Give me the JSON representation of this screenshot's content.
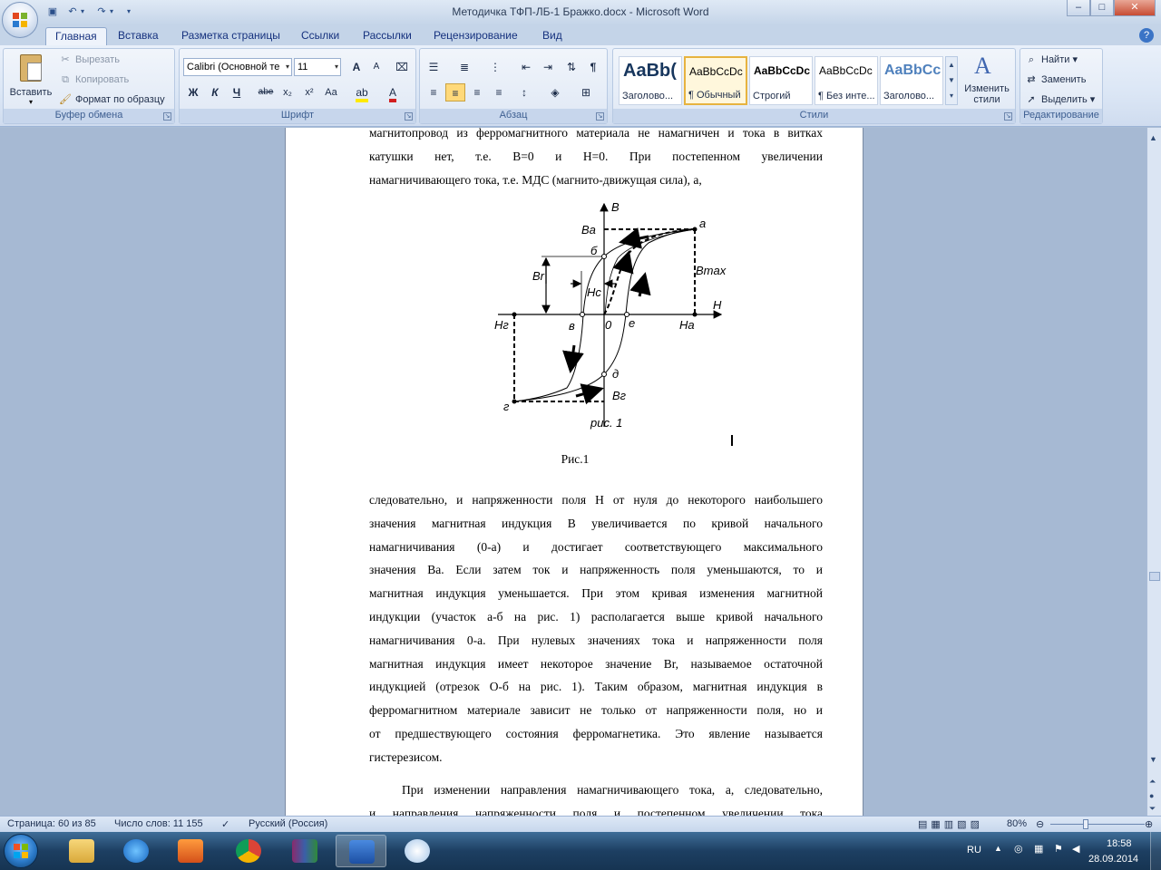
{
  "window": {
    "title": "Методичка ТФП-ЛБ-1 Бражко.docx - Microsoft Word",
    "minimize": "–",
    "maximize": "□",
    "close": "✕"
  },
  "qat": {
    "save_icon": "save-icon",
    "undo_icon": "undo-icon",
    "redo_icon": "redo-icon"
  },
  "tabs": [
    "Главная",
    "Вставка",
    "Разметка страницы",
    "Ссылки",
    "Рассылки",
    "Рецензирование",
    "Вид"
  ],
  "ribbon": {
    "clipboard": {
      "label": "Буфер обмена",
      "paste": "Вставить",
      "cut": "Вырезать",
      "copy": "Копировать",
      "format_painter": "Формат по образцу"
    },
    "font": {
      "label": "Шрифт",
      "font_name": "Calibri (Основной те",
      "font_size": "11",
      "bold": "Ж",
      "italic": "К",
      "underline": "Ч",
      "strike": "abe",
      "subscript": "x₂",
      "superscript": "x²",
      "change_case": "Aa",
      "grow": "A",
      "shrink": "A"
    },
    "paragraph": {
      "label": "Абзац"
    },
    "styles": {
      "label": "Стили",
      "items": [
        {
          "sample": "AaBb(",
          "name": "Заголово..."
        },
        {
          "sample": "AaBbCcDc",
          "name": "¶ Обычный"
        },
        {
          "sample": "AaBbCcDc",
          "name": "Строгий"
        },
        {
          "sample": "AaBbCcDc",
          "name": "¶ Без инте..."
        },
        {
          "sample": "AaBbCc",
          "name": "Заголово..."
        }
      ],
      "change_styles": "Изменить стили"
    },
    "editing": {
      "label": "Редактирование",
      "find": "Найти",
      "replace": "Заменить",
      "select": "Выделить"
    }
  },
  "document": {
    "para1": [
      "магнитопровод из ферромагнитного материала не намагничен и тока в витках",
      "катушки   нет,   т.е.   B=0   и   H=0.   При   постепенном   увеличении",
      "намагничивающего тока, т.е. МДС (магнито-движущая сила), а,"
    ],
    "figure": {
      "axis_B": "B",
      "axis_H": "H",
      "Ba": "Bа",
      "a": "а",
      "b": "б",
      "Br": "Br",
      "Bmax": "Bmax",
      "Hc": "Hc",
      "Hg": "Hг",
      "v": "в",
      "zero": "0",
      "e": "е",
      "Ha": "Hа",
      "d": "д",
      "Bg": "Bг",
      "g": "г",
      "fig_label": "рис. 1"
    },
    "caption": "Рис.1",
    "para2": [
      "следовательно, и напряженности поля H от нуля до некоторого наибольшего",
      "значения  магнитная индукция B увеличивается по кривой начального",
      "намагничивания (0-а) и достигает соответствующего максимального",
      "значения Ba. Если затем ток и напряженность поля уменьшаются, то и",
      "магнитная индукция уменьшается. При этом кривая изменения магнитной",
      "индукции (участок а-б на рис. 1) располагается выше кривой начального",
      "намагничивания 0-а. При нулевых значениях тока и напряженности поля",
      "магнитная индукция имеет некоторое значение Br, называемое остаточной",
      "индукцией (отрезок О-б на рис. 1). Таким образом, магнитная индукция в",
      "ферромагнитном материале зависит не только от напряженности поля, но и",
      "от предшествующего состояния ферромагнетика. Это явление называется",
      "гистерезисом."
    ],
    "para3": [
      "При изменении направления намагничивающего тока, а, следовательно,",
      "и направления напряженности поля и постепенном увеличении тока"
    ]
  },
  "statusbar": {
    "page": "Страница: 60 из 85",
    "words": "Число слов: 11 155",
    "language": "Русский (Россия)",
    "zoom": "80%"
  },
  "taskbar": {
    "lang": "RU",
    "time": "18:58",
    "date": "28.09.2014"
  }
}
